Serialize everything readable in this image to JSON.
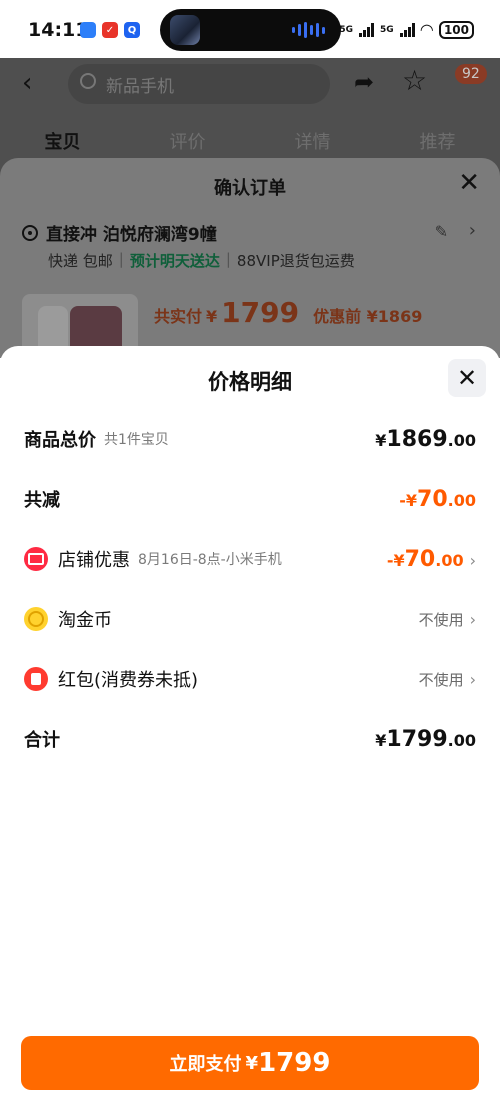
{
  "status_bar": {
    "time": "14:11",
    "network_1": "5G",
    "network_2": "5G",
    "battery": "100"
  },
  "background_page": {
    "search_placeholder": "新品手机",
    "cart_badge": "92",
    "tabs": [
      "宝贝",
      "评价",
      "详情",
      "推荐"
    ]
  },
  "confirm_order": {
    "title": "确认订单",
    "address": "直接冲 泊悦府澜湾9幢",
    "shipping": [
      "快递 包邮",
      "预计明天送达",
      "88VIP退货包运费"
    ],
    "actual_pay_label": "共实付",
    "actual_pay_symbol": "¥",
    "actual_pay_amount": "1799",
    "before_discount": "优惠前 ¥1869"
  },
  "price_detail": {
    "title": "价格明细",
    "rows": {
      "total": {
        "label": "商品总价",
        "sub": "共1件宝贝",
        "symbol": "¥",
        "int": "1869",
        "dec": ".00"
      },
      "reduction": {
        "label": "共减",
        "symbol": "-¥",
        "int": "70",
        "dec": ".00"
      },
      "shop_discount": {
        "label": "店铺优惠",
        "sub": "8月16日-8点-小米手机",
        "symbol": "-¥",
        "int": "70",
        "dec": ".00"
      },
      "taojinbi": {
        "label": "淘金币",
        "value": "不使用"
      },
      "red_packet": {
        "label": "红包(消费券未抵)",
        "value": "不使用"
      },
      "sum": {
        "label": "合计",
        "symbol": "¥",
        "int": "1799",
        "dec": ".00"
      }
    }
  },
  "pay_button": {
    "label": "立即支付",
    "symbol": "¥",
    "amount": "1799"
  },
  "colors": {
    "accent_orange": "#ff6a00",
    "discount_orange": "#ff5a00",
    "green_text": "#0f5f3a"
  }
}
